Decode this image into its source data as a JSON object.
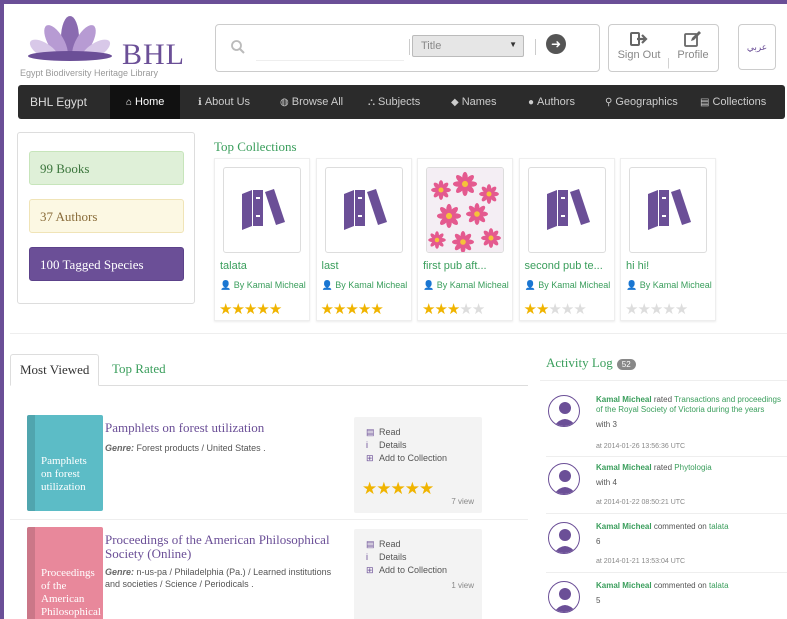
{
  "brand": {
    "logo_text": "BHL",
    "logo_subtitle": "Egypt Biodiversity Heritage Library"
  },
  "search": {
    "placeholder": "",
    "select_value": "Title"
  },
  "user_menu": {
    "sign_out": "Sign Out",
    "sep": "|",
    "profile": "Profile",
    "language": "عربي"
  },
  "nav": {
    "brand": "BHL Egypt",
    "items": [
      {
        "label": "Home",
        "icon": "home-icon"
      },
      {
        "label": "About Us",
        "icon": "info-icon"
      },
      {
        "label": "Browse All",
        "icon": "globe-icon"
      },
      {
        "label": "Subjects",
        "icon": "sitemap-icon"
      },
      {
        "label": "Names",
        "icon": "tags-icon"
      },
      {
        "label": "Authors",
        "icon": "user-icon"
      },
      {
        "label": "Geographics",
        "icon": "map-marker-icon"
      },
      {
        "label": "Collections",
        "icon": "book-icon"
      }
    ]
  },
  "stats": {
    "books": "99 Books",
    "authors": "37 Authors",
    "species": "100 Tagged Species"
  },
  "top_collections": {
    "title": "Top Collections",
    "items": [
      {
        "name": "talata",
        "by": "By Kamal Micheal",
        "rating": 5,
        "thumb": "books-icon"
      },
      {
        "name": "last",
        "by": "By Kamal Micheal",
        "rating": 5,
        "thumb": "books-icon"
      },
      {
        "name": "first pub aft...",
        "by": "By Kamal Micheal",
        "rating": 3,
        "thumb": "flowers-photo"
      },
      {
        "name": "second pub te...",
        "by": "By Kamal Micheal",
        "rating": 2,
        "thumb": "books-icon"
      },
      {
        "name": "hi hi!",
        "by": "By Kamal Micheal",
        "rating": 0,
        "thumb": "books-icon"
      }
    ]
  },
  "tabs": {
    "most_viewed": "Most Viewed",
    "top_rated": "Top Rated"
  },
  "books": [
    {
      "cover_text": "Pamphlets on forest utilization",
      "cover_color": "#5cbcc6",
      "title": "Pamphlets on forest utilization",
      "genre_label": "Genre:",
      "genre": "Forest products / United States .",
      "read": "Read",
      "details": "Details",
      "add": "Add to Collection",
      "views": "7 view",
      "rating": 5
    },
    {
      "cover_text": "Proceedings of the American Philosophical",
      "cover_color": "#e8889b",
      "title": "Proceedings of the American Philosophical Society (Online)",
      "genre_label": "Genre:",
      "genre": "n-us-pa / Philadelphia (Pa.) / Learned institutions and societies / Science / Periodicals .",
      "read": "Read",
      "details": "Details",
      "add": "Add to Collection",
      "views": "1 view",
      "rating": 0
    }
  ],
  "activity": {
    "title": "Activity Log",
    "count": "52",
    "items": [
      {
        "user": "Kamal Micheal",
        "action": "rated",
        "target": "Transactions and proceedings of the Royal Society of Victoria during the years",
        "detail": "with 3",
        "time": "at 2014-01-26 13:56:36 UTC"
      },
      {
        "user": "Kamal Micheal",
        "action": "rated",
        "target": "Phytologia",
        "detail": "with 4",
        "time": "at 2014-01-22 08:50:21 UTC"
      },
      {
        "user": "Kamal Micheal",
        "action": "commented on",
        "target": "talata",
        "detail": "6",
        "time": "at 2014-01-21 13:53:04 UTC"
      },
      {
        "user": "Kamal Micheal",
        "action": "commented on",
        "target": "talata",
        "detail": "5",
        "time": ""
      }
    ]
  }
}
